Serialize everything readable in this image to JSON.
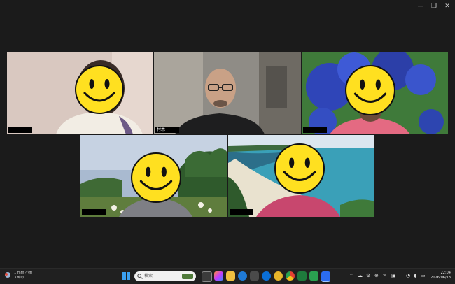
{
  "window": {
    "minimize": "—",
    "restore": "❐",
    "close": "✕"
  },
  "participants": [
    {
      "name": ""
    },
    {
      "name": "村木"
    },
    {
      "name": ""
    },
    {
      "name": ""
    },
    {
      "name": ""
    }
  ],
  "taskbar": {
    "weather_line1": "1 mm  小雨",
    "weather_line2": "3 時以",
    "search_placeholder": "検索",
    "time": "22:04",
    "date": "2026/06/18"
  },
  "colors": {
    "active_speaker": "#3ec96a",
    "face": "#ffe020"
  }
}
